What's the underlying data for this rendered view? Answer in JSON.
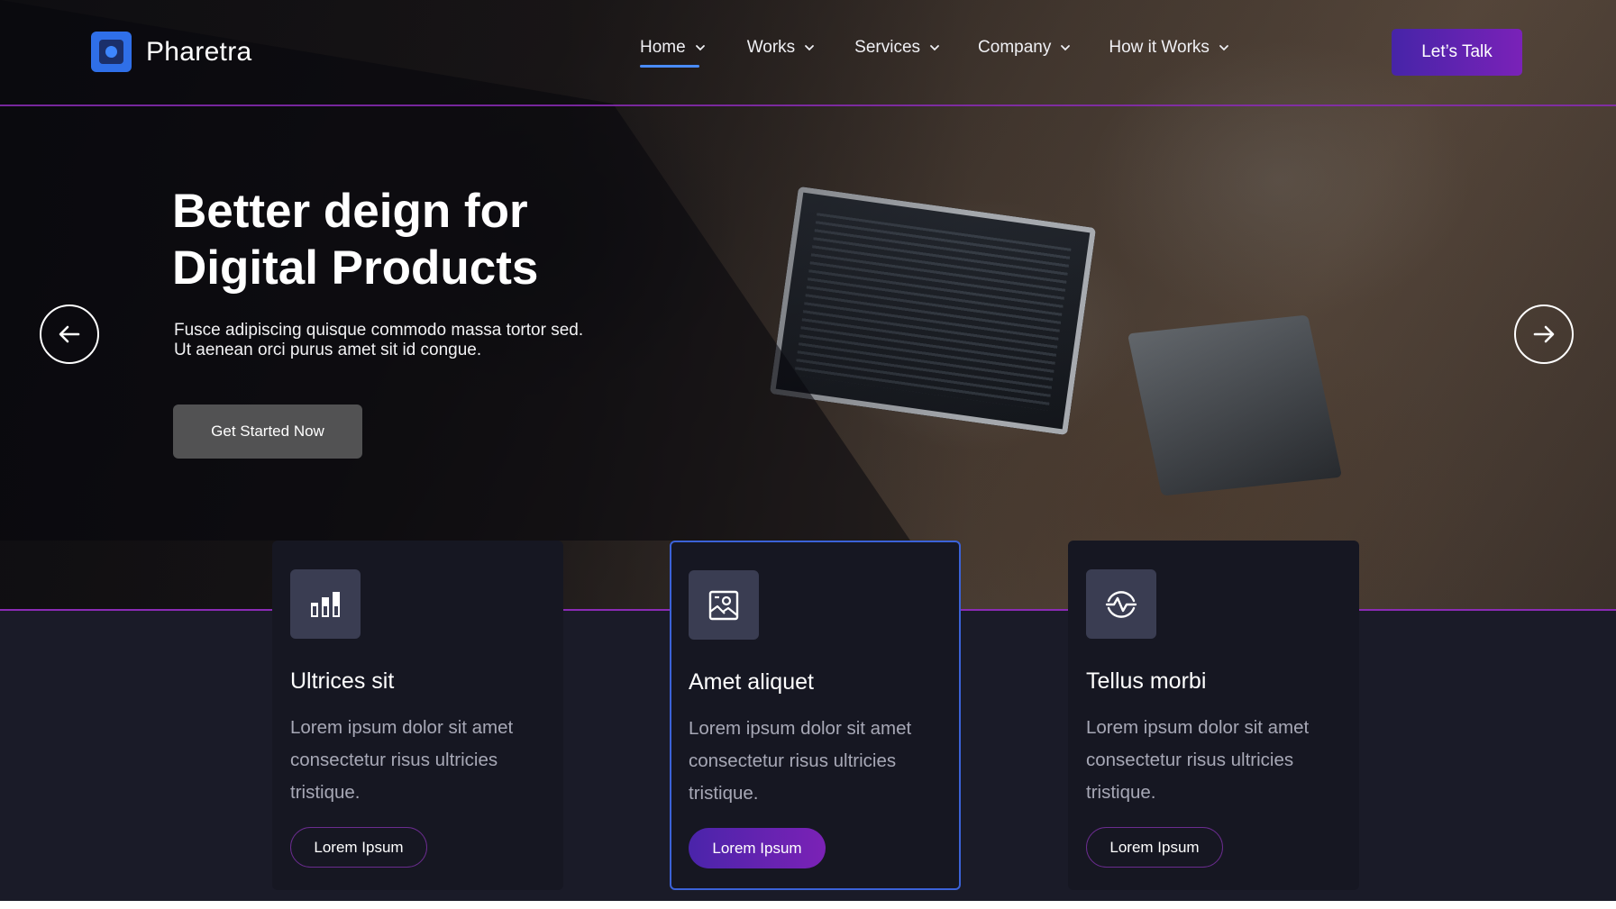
{
  "brand": {
    "name": "Pharetra",
    "accent": "#2f6fe8"
  },
  "nav": {
    "items": [
      {
        "label": "Home",
        "active": true
      },
      {
        "label": "Works"
      },
      {
        "label": "Services"
      },
      {
        "label": "Company"
      },
      {
        "label": "How it Works"
      }
    ],
    "cta_label": "Let’s Talk"
  },
  "hero": {
    "title_line1": "Better deign for",
    "title_line2": "Digital Products",
    "subtitle": "Fusce adipiscing quisque commodo massa tortor sed. Ut aenean orci purus amet sit id congue.",
    "cta_label": "Get Started Now",
    "prev_icon": "arrow-left-icon",
    "next_icon": "arrow-right-icon"
  },
  "cards": [
    {
      "icon": "bar-chart-icon",
      "title": "Ultrices sit",
      "text": "Lorem ipsum dolor sit amet consectetur risus ultricies tristique.",
      "button": "Lorem Ipsum"
    },
    {
      "icon": "image-frame-icon",
      "title": "Amet aliquet",
      "text": "Lorem ipsum dolor sit amet consectetur risus ultricies tristique.",
      "button": "Lorem Ipsum",
      "featured": true
    },
    {
      "icon": "activity-pulse-icon",
      "title": "Tellus morbi",
      "text": "Lorem ipsum dolor sit amet consectetur risus ultricies tristique.",
      "button": "Lorem Ipsum"
    }
  ],
  "colors": {
    "background": "#1a1b28",
    "card": "#161722",
    "featured_border": "#3b62d8",
    "button_gradient_start": "#4624a8",
    "button_gradient_end": "#7a22b8",
    "divider": "#8a2bb5"
  }
}
